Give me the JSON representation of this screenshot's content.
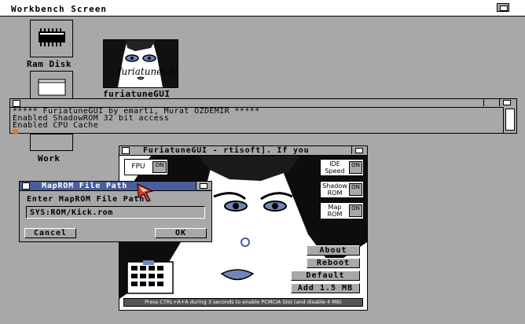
{
  "screen": {
    "title": "Workbench Screen"
  },
  "desktop": {
    "icons": [
      {
        "label": "Ram Disk",
        "icon": "ram-chip-icon"
      },
      {
        "label": "furiatuneGUI",
        "icon": "furiatune-portrait-icon"
      },
      {
        "label": "Work",
        "icon": "hard-drive-icon"
      }
    ]
  },
  "shell": {
    "lines": [
      "***** FuriatuneGUI by emarti, Murat OZDEMIR *****",
      "Enabled ShadowROM 32 bit access",
      "Enabled CPU Cache"
    ],
    "cursor_color": "#e07a20"
  },
  "furiatune": {
    "title": "FuriatuneGUI - rtisoft]. If you",
    "toggles": {
      "fpu": {
        "label": "FPU",
        "state": "ON"
      },
      "ide": {
        "label_line1": "IDE",
        "label_line2": "Speed",
        "state": "ON"
      },
      "shadow": {
        "label_line1": "Shadow",
        "label_line2": "ROM",
        "state": "ON"
      },
      "map": {
        "label_line1": "Map",
        "label_line2": "ROM",
        "state": "ON"
      }
    },
    "buttons": {
      "about": "About",
      "reboot": "Reboot",
      "default": "Default",
      "add": "Add 1.5 MB"
    },
    "status": "Press CTRL+A+A during 3 seconds to enable PCMCIA Slot (and disable 4 MB)"
  },
  "dialog": {
    "title": "MapROM File Path",
    "prompt": "Enter MapROM File Path",
    "path_value": "SYS:ROM/Kick.rom",
    "cancel": "Cancel",
    "ok": "OK"
  },
  "colors": {
    "workbench_gray": "#a8a8a8",
    "dialog_titlebar": "#4a5e9a",
    "toggle_on": "#a8a8a8",
    "pointer_red": "#d23a2a"
  }
}
